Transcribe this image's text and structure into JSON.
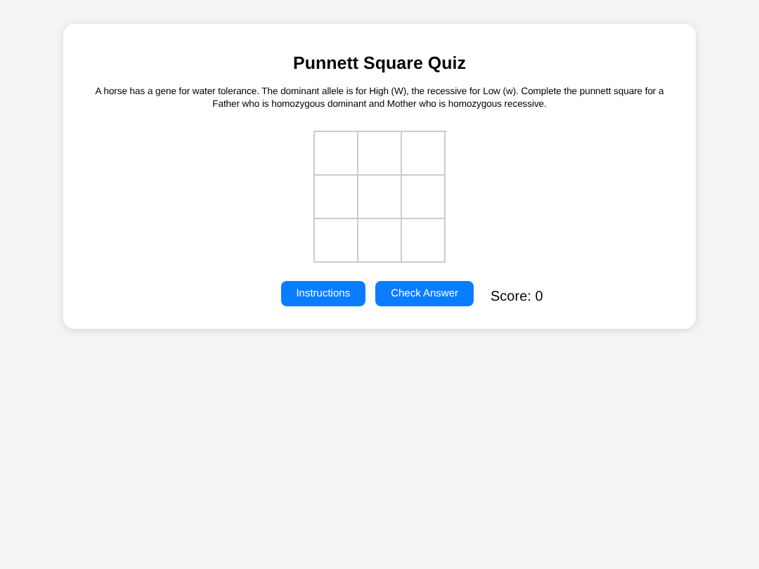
{
  "title": "Punnett Square Quiz",
  "question": "A horse has a gene for water tolerance. The dominant allele is for High (W), the recessive for Low (w). Complete the punnett square for a Father who is homozygous dominant and Mother who is homozygous recessive.",
  "square": {
    "rows": [
      [
        {
          "kind": "blank"
        },
        {
          "kind": "blank"
        },
        {
          "kind": "blank"
        }
      ],
      [
        {
          "kind": "blank"
        },
        {
          "kind": "blank"
        },
        {
          "kind": "blank"
        }
      ],
      [
        {
          "kind": "blank"
        },
        {
          "kind": "blank"
        },
        {
          "kind": "blank"
        }
      ]
    ]
  },
  "buttons": [
    "Instructions",
    "Check Answer"
  ],
  "score": "Score: 0"
}
